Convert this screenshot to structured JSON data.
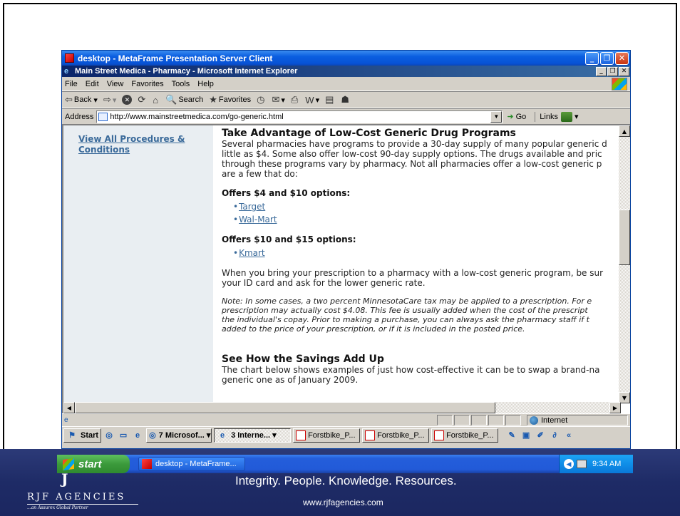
{
  "metaframe": {
    "title": "desktop - MetaFrame Presentation Server Client"
  },
  "ie": {
    "title": "Main Street Medica - Pharmacy - Microsoft Internet Explorer",
    "menus": [
      "File",
      "Edit",
      "View",
      "Favorites",
      "Tools",
      "Help"
    ],
    "toolbar": {
      "back": "Back",
      "search": "Search",
      "favorites": "Favorites"
    },
    "address": {
      "label": "Address",
      "url": "http://www.mainstreetmedica.com/go-generic.html",
      "go": "Go",
      "links": "Links"
    }
  },
  "sidebar": {
    "link": "View All Procedures & Conditions"
  },
  "article": {
    "heading": "Take Advantage of Low-Cost Generic Drug Programs",
    "intro": [
      "Several pharmacies have programs to provide a 30-day supply of many popular generic d",
      "little as $4. Some also offer low-cost 90-day supply options. The drugs available and pric",
      "through these programs vary by pharmacy. Not all pharmacies offer a low-cost generic p",
      "are a few that do:"
    ],
    "group1_title": "Offers $4 and $10 options:",
    "group1_links": [
      "Target",
      "Wal-Mart"
    ],
    "group2_title": "Offers $10 and $15 options:",
    "group2_links": [
      "Kmart"
    ],
    "prescription": [
      "When you bring your prescription to a pharmacy with a low-cost generic program, be sur",
      "your ID card and ask for the lower generic rate."
    ],
    "note": [
      "Note: In some cases, a two percent MinnesotaCare tax may be applied to a prescription. For e",
      "prescription may actually cost $4.08. This fee is usually added when the cost of the prescript",
      "the individual's copay. Prior to making a purchase, you can always ask the pharmacy staff if t",
      "added to the price of your prescription, or if it is included in the posted price."
    ],
    "savings_heading": "See How the Savings Add Up",
    "savings": [
      "The chart below shows examples of just how cost-effective it can be to swap a brand-na",
      "generic one as of January 2009."
    ]
  },
  "status": {
    "zone": "Internet"
  },
  "inner_taskbar": {
    "start": "Start",
    "tasks": [
      "7 Microsof...",
      "3 Interne...",
      "Forstbike_P...",
      "Forstbike_P...",
      "Forstbike_P..."
    ]
  },
  "xp_taskbar": {
    "start": "start",
    "task": "desktop - MetaFrame...",
    "clock": "9:34 AM"
  },
  "footer": {
    "tagline": "Integrity. People. Knowledge. Resources.",
    "website": "www.rjfagencies.com",
    "logo_mark": "J",
    "logo_name": "RJF AGENCIES",
    "logo_sub": "...an Assurex Global Partner"
  },
  "colors": {
    "link": "#3a6a9a",
    "xp_blue": "#245edb",
    "band": "#1e2b66"
  }
}
